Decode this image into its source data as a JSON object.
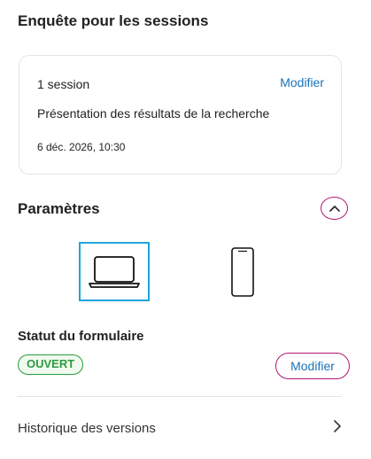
{
  "survey": {
    "title": "Enquête pour les sessions"
  },
  "session_card": {
    "count": "1 session",
    "modify_label": "Modifier",
    "session_title": "Présentation des résultats de la recherche",
    "session_datetime": "6 déc. 2026, 10:30"
  },
  "parameters": {
    "title": "Paramètres",
    "collapse_icon": "chevron-up-icon",
    "devices": [
      {
        "icon": "laptop-icon",
        "selected": true
      },
      {
        "icon": "mobile-phone-icon",
        "selected": false
      }
    ],
    "selected_color": "#1da5dc"
  },
  "form_status": {
    "label": "Statut du formulaire",
    "badge": "OUVERT",
    "badge_color": "#2e9b3e",
    "modify_label": "Modifier"
  },
  "history": {
    "label": "Historique des versions",
    "chevron_icon": "chevron-right-icon"
  },
  "colors": {
    "accent_link": "#1a73b8",
    "accent_border": "#b0176e"
  }
}
